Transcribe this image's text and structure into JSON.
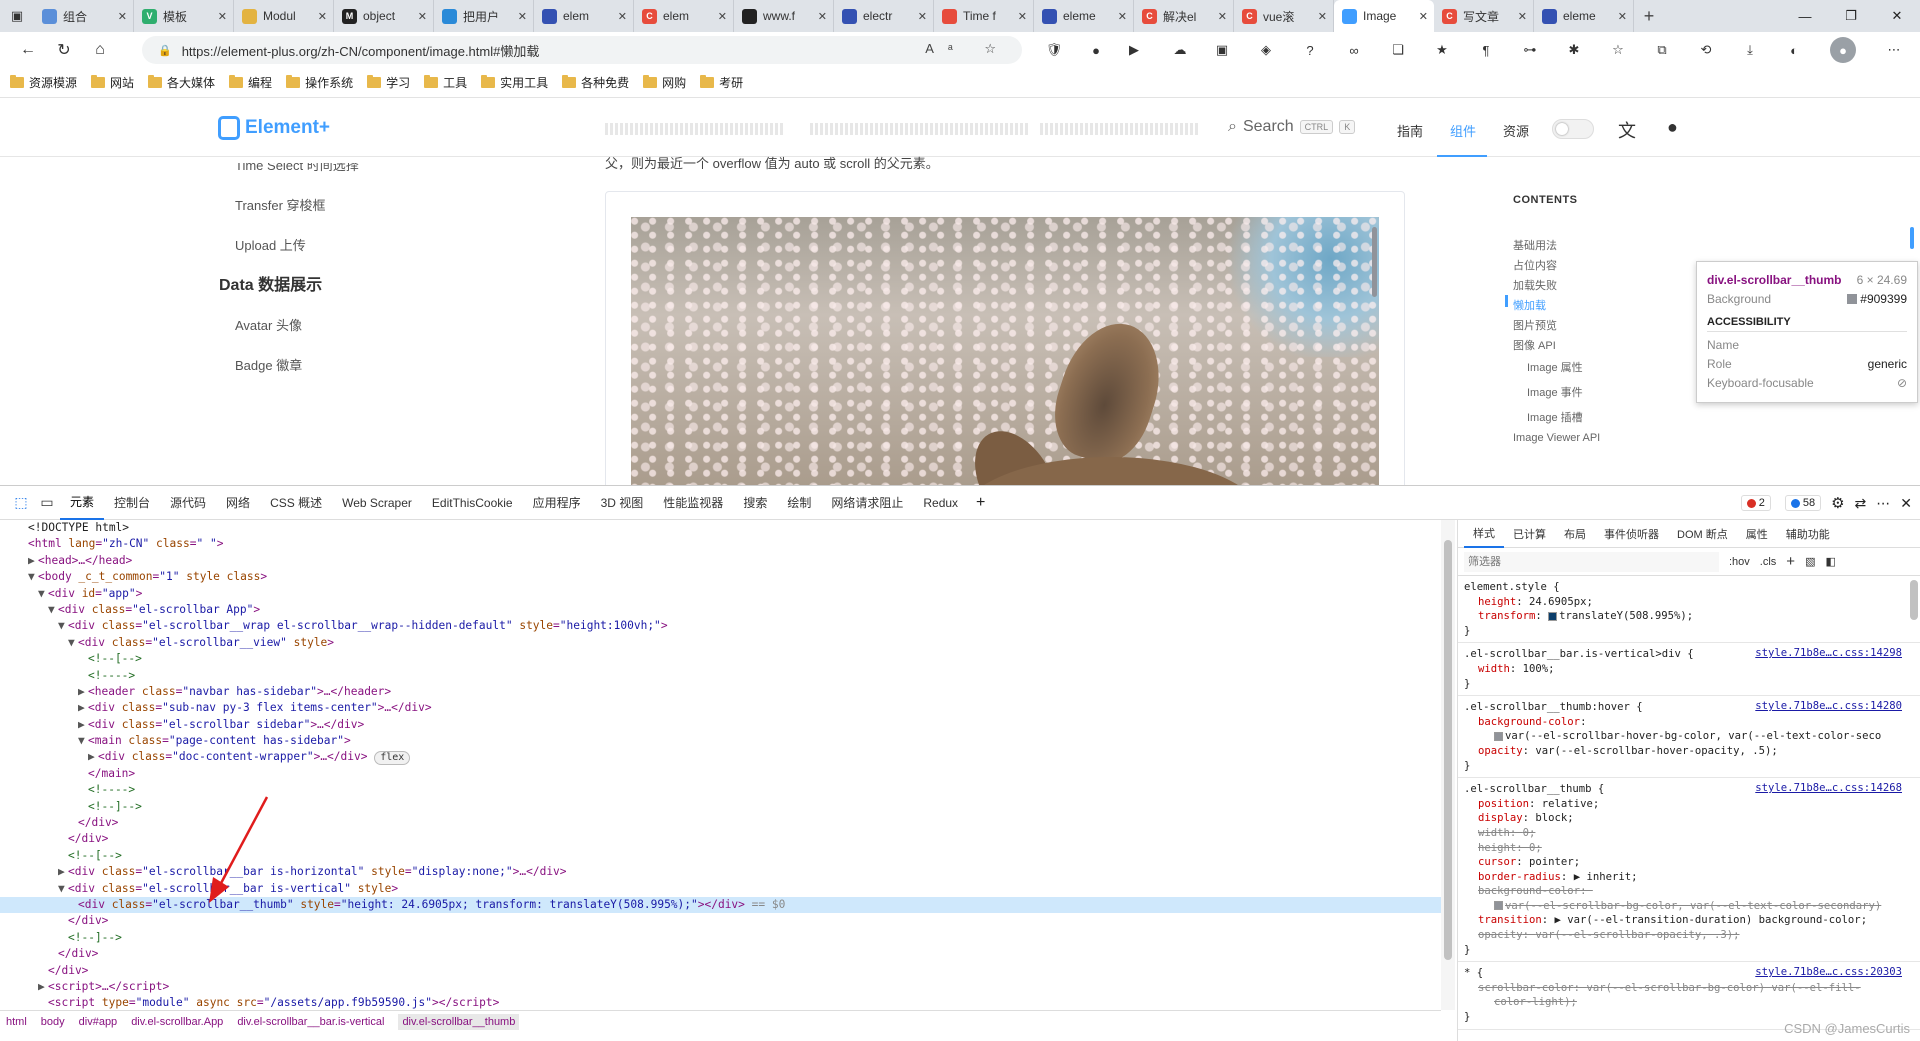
{
  "tabs": [
    {
      "title": "组合",
      "color": "#5b8fd9",
      "letter": "",
      "active": false
    },
    {
      "title": "模板",
      "color": "#2fae6e",
      "letter": "V",
      "active": false
    },
    {
      "title": "Modul",
      "color": "#e3b341",
      "letter": "",
      "active": false
    },
    {
      "title": "object",
      "color": "#222222",
      "letter": "M",
      "active": false
    },
    {
      "title": "把用户",
      "color": "#2a8ad8",
      "letter": "",
      "active": false
    },
    {
      "title": "elem",
      "color": "#3451b2",
      "letter": "",
      "active": false
    },
    {
      "title": "elem",
      "color": "#e74c3c",
      "letter": "C",
      "active": false
    },
    {
      "title": "www.f",
      "color": "#222222",
      "letter": "",
      "active": false
    },
    {
      "title": "electr",
      "color": "#3451b2",
      "letter": "",
      "active": false
    },
    {
      "title": "Time f",
      "color": "#e74c3c",
      "letter": "",
      "active": false
    },
    {
      "title": "eleme",
      "color": "#3451b2",
      "letter": "",
      "active": false
    },
    {
      "title": "解决el",
      "color": "#e74c3c",
      "letter": "C",
      "active": false
    },
    {
      "title": "vue滚",
      "color": "#e74c3c",
      "letter": "C",
      "active": false
    },
    {
      "title": "Image",
      "color": "#409eff",
      "letter": "",
      "active": true
    },
    {
      "title": "写文章",
      "color": "#e74c3c",
      "letter": "C",
      "active": false
    },
    {
      "title": "eleme",
      "color": "#3451b2",
      "letter": "",
      "active": false
    }
  ],
  "url": "https://element-plus.org/zh-CN/component/image.html#懒加载",
  "bookmarks": [
    "资源模源",
    "网站",
    "各大媒体",
    "编程",
    "操作系统",
    "学习",
    "工具",
    "实用工具",
    "各种免费",
    "网购",
    "考研"
  ],
  "site": {
    "logo_text": "Element+",
    "search_label": "Search",
    "kbd1": "CTRL",
    "kbd2": "K",
    "nav": [
      "指南",
      "组件",
      "资源"
    ]
  },
  "sidebar": {
    "cut_item": "Time Select 时间选择",
    "items": [
      "Transfer 穿梭框",
      "Upload 上传"
    ],
    "group": "Data 数据展示",
    "group_items": [
      "Avatar 头像",
      "Badge 徽章"
    ]
  },
  "content_line": "父，则为最近一个 overflow 值为 auto 或 scroll 的父元素。",
  "toc": {
    "title": "CONTENTS",
    "items": [
      {
        "label": "基础用法",
        "sub": false,
        "active": false
      },
      {
        "label": "占位内容",
        "sub": false,
        "active": false
      },
      {
        "label": "加载失败",
        "sub": false,
        "active": false
      },
      {
        "label": "懒加载",
        "sub": false,
        "active": true
      },
      {
        "label": "图片预览",
        "sub": false,
        "active": false
      },
      {
        "label": "图像 API",
        "sub": false,
        "active": false
      },
      {
        "label": "Image 属性",
        "sub": true,
        "active": false
      },
      {
        "label": "Image 事件",
        "sub": true,
        "active": false
      },
      {
        "label": "Image 插槽",
        "sub": true,
        "active": false
      },
      {
        "label": "Image Viewer API",
        "sub": false,
        "active": false
      }
    ]
  },
  "tooltip": {
    "selector": "div.el-scrollbar__thumb",
    "size": "6 × 24.69",
    "bg_label": "Background",
    "bg_value": "#909399",
    "section": "ACCESSIBILITY",
    "name_label": "Name",
    "role_label": "Role",
    "role_value": "generic",
    "kf_label": "Keyboard-focusable"
  },
  "devtools": {
    "tabs": [
      "元素",
      "控制台",
      "源代码",
      "网络",
      "CSS 概述",
      "Web Scraper",
      "EditThisCookie",
      "应用程序",
      "3D 视图",
      "性能监视器",
      "搜索",
      "绘制",
      "网络请求阻止",
      "Redux"
    ],
    "errors": "2",
    "messages": "58",
    "dom_lines": [
      {
        "indent": 0,
        "tri": "",
        "html": "<span class='tx'>&lt;!DOCTYPE html&gt;</span>"
      },
      {
        "indent": 0,
        "tri": "",
        "html": "&lt;html <span class='an'>lang</span>=<span class='av'>\"zh-CN\"</span> <span class='an'>class</span>=<span class='av'>\" \"</span>&gt;"
      },
      {
        "indent": 1,
        "tri": "▶",
        "html": "&lt;head&gt;…&lt;/head&gt;"
      },
      {
        "indent": 1,
        "tri": "▼",
        "html": "&lt;body <span class='an'>_c_t_common</span>=<span class='av'>\"1\"</span> <span class='an'>style class</span>&gt;"
      },
      {
        "indent": 2,
        "tri": "▼",
        "html": "&lt;div <span class='an'>id</span>=<span class='av'>\"app\"</span>&gt;"
      },
      {
        "indent": 3,
        "tri": "▼",
        "html": "&lt;div <span class='an'>class</span>=<span class='av'>\"el-scrollbar App\"</span>&gt;"
      },
      {
        "indent": 4,
        "tri": "▼",
        "html": "&lt;div <span class='an'>class</span>=<span class='av'>\"el-scrollbar__wrap el-scrollbar__wrap--hidden-default\"</span> <span class='an'>style</span>=<span class='av'>\"height:100vh;\"</span>&gt;"
      },
      {
        "indent": 5,
        "tri": "▼",
        "html": "&lt;div <span class='an'>class</span>=<span class='av'>\"el-scrollbar__view\"</span> <span class='an'>style</span>&gt;"
      },
      {
        "indent": 6,
        "tri": "",
        "html": "<span class='cm'>&lt;!--[--&gt;</span>"
      },
      {
        "indent": 6,
        "tri": "",
        "html": "<span class='cm'>&lt;!----&gt;</span>"
      },
      {
        "indent": 6,
        "tri": "▶",
        "html": "&lt;header <span class='an'>class</span>=<span class='av'>\"navbar has-sidebar\"</span>&gt;…&lt;/header&gt;"
      },
      {
        "indent": 6,
        "tri": "▶",
        "html": "&lt;div <span class='an'>class</span>=<span class='av'>\"sub-nav py-3 flex items-center\"</span>&gt;…&lt;/div&gt;"
      },
      {
        "indent": 6,
        "tri": "▶",
        "html": "&lt;div <span class='an'>class</span>=<span class='av'>\"el-scrollbar sidebar\"</span>&gt;…&lt;/div&gt;"
      },
      {
        "indent": 6,
        "tri": "▼",
        "html": "&lt;main <span class='an'>class</span>=<span class='av'>\"page-content has-sidebar\"</span>&gt;"
      },
      {
        "indent": 7,
        "tri": "▶",
        "html": "&lt;div <span class='an'>class</span>=<span class='av'>\"doc-content-wrapper\"</span>&gt;…&lt;/div&gt; <span class='fxbadge'>flex</span>"
      },
      {
        "indent": 6,
        "tri": "",
        "html": "&lt;/main&gt;"
      },
      {
        "indent": 6,
        "tri": "",
        "html": "<span class='cm'>&lt;!----&gt;</span>"
      },
      {
        "indent": 6,
        "tri": "",
        "html": "<span class='cm'>&lt;!--]--&gt;</span>"
      },
      {
        "indent": 5,
        "tri": "",
        "html": "&lt;/div&gt;"
      },
      {
        "indent": 4,
        "tri": "",
        "html": "&lt;/div&gt;"
      },
      {
        "indent": 4,
        "tri": "",
        "html": "<span class='cm'>&lt;!--[--&gt;</span>"
      },
      {
        "indent": 4,
        "tri": "▶",
        "html": "&lt;div <span class='an'>class</span>=<span class='av'>\"el-scrollbar__bar is-horizontal\"</span> <span class='an'>style</span>=<span class='av'>\"display:none;\"</span>&gt;…&lt;/div&gt;"
      },
      {
        "indent": 4,
        "tri": "▼",
        "html": "&lt;div <span class='an'>class</span>=<span class='av'>\"el-scrollbar__bar is-vertical\"</span> <span class='an'>style</span>&gt;"
      },
      {
        "indent": 5,
        "tri": "",
        "sel": true,
        "html": "&lt;div <span class='an'>class</span>=<span class='av'>\"el-scrollbar__thumb\"</span> <span class='an'>style</span>=<span class='av'>\"height: 24.6905px; transform: translateY(508.995%);\"</span>&gt;&lt;/div&gt; <span style='color:#888'>== $0</span>"
      },
      {
        "indent": 4,
        "tri": "",
        "html": "&lt;/div&gt;"
      },
      {
        "indent": 4,
        "tri": "",
        "html": "<span class='cm'>&lt;!--]--&gt;</span>"
      },
      {
        "indent": 3,
        "tri": "",
        "html": "&lt;/div&gt;"
      },
      {
        "indent": 2,
        "tri": "",
        "html": "&lt;/div&gt;"
      },
      {
        "indent": 2,
        "tri": "▶",
        "html": "&lt;script&gt;…&lt;/script&gt;"
      },
      {
        "indent": 2,
        "tri": "",
        "html": "&lt;script <span class='an'>type</span>=<span class='av'>\"module\"</span> <span class='an'>async src</span>=<span class='av'>\"/assets/app.f9b59590.js\"</span>&gt;&lt;/script&gt;"
      }
    ],
    "breadcrumbs": [
      "html",
      "body",
      "div#app",
      "div.el-scrollbar.App",
      "div.el-scrollbar__bar.is-vertical",
      "div.el-scrollbar__thumb"
    ],
    "style_tabs": [
      "样式",
      "已计算",
      "布局",
      "事件侦听器",
      "DOM 断点",
      "属性",
      "辅助功能"
    ],
    "filter_placeholder": "筛选器",
    "hov": ":hov",
    "cls": ".cls",
    "rules": [
      {
        "selector": "element.style {",
        "src": "",
        "props": [
          {
            "n": "height",
            "v": "24.6905px;",
            "s": false
          },
          {
            "n": "transform",
            "v": "translateY(508.995%);",
            "s": false,
            "sw": "#0b3e6b"
          }
        ]
      },
      {
        "selector": ".el-scrollbar__bar.is-vertical>div {",
        "src": "style.71b8e…c.css:14298",
        "props": [
          {
            "n": "width",
            "v": "100%;",
            "s": false
          }
        ]
      },
      {
        "selector": ".el-scrollbar__thumb:hover {",
        "src": "style.71b8e…c.css:14280",
        "props": [
          {
            "n": "background-color",
            "v": "",
            "s": false
          },
          {
            "n": "",
            "v": "var(--el-scrollbar-hover-bg-color, var(--el-text-color-seco",
            "s": false,
            "sw": "#909399"
          },
          {
            "n": "opacity",
            "v": "var(--el-scrollbar-hover-opacity, .5);",
            "s": false
          }
        ]
      },
      {
        "selector": ".el-scrollbar__thumb {",
        "src": "style.71b8e…c.css:14268",
        "props": [
          {
            "n": "position",
            "v": "relative;",
            "s": false
          },
          {
            "n": "display",
            "v": "block;",
            "s": false
          },
          {
            "n": "width",
            "v": "0;",
            "s": true
          },
          {
            "n": "height",
            "v": "0;",
            "s": true
          },
          {
            "n": "cursor",
            "v": "pointer;",
            "s": false
          },
          {
            "n": "border-radius",
            "v": "▶ inherit;",
            "s": false
          },
          {
            "n": "background-color",
            "v": "",
            "s": true
          },
          {
            "n": "",
            "v": "var(--el-scrollbar-bg-color, var(--el-text-color-secondary)",
            "s": true,
            "sw": "#909399"
          },
          {
            "n": "transition",
            "v": "▶ var(--el-transition-duration) background-color;",
            "s": false
          },
          {
            "n": "opacity",
            "v": "var(--el-scrollbar-opacity, .3);",
            "s": true
          }
        ]
      },
      {
        "selector": "* {",
        "src": "style.71b8e…c.css:20303",
        "props": [
          {
            "n": "scrollbar-color",
            "v": "var(--el-scrollbar-bg-color) var(--el-fill-",
            "s": true
          },
          {
            "n": "",
            "v": "color-light);",
            "s": true
          }
        ]
      }
    ]
  },
  "watermark": "CSDN @JamesCurtis"
}
